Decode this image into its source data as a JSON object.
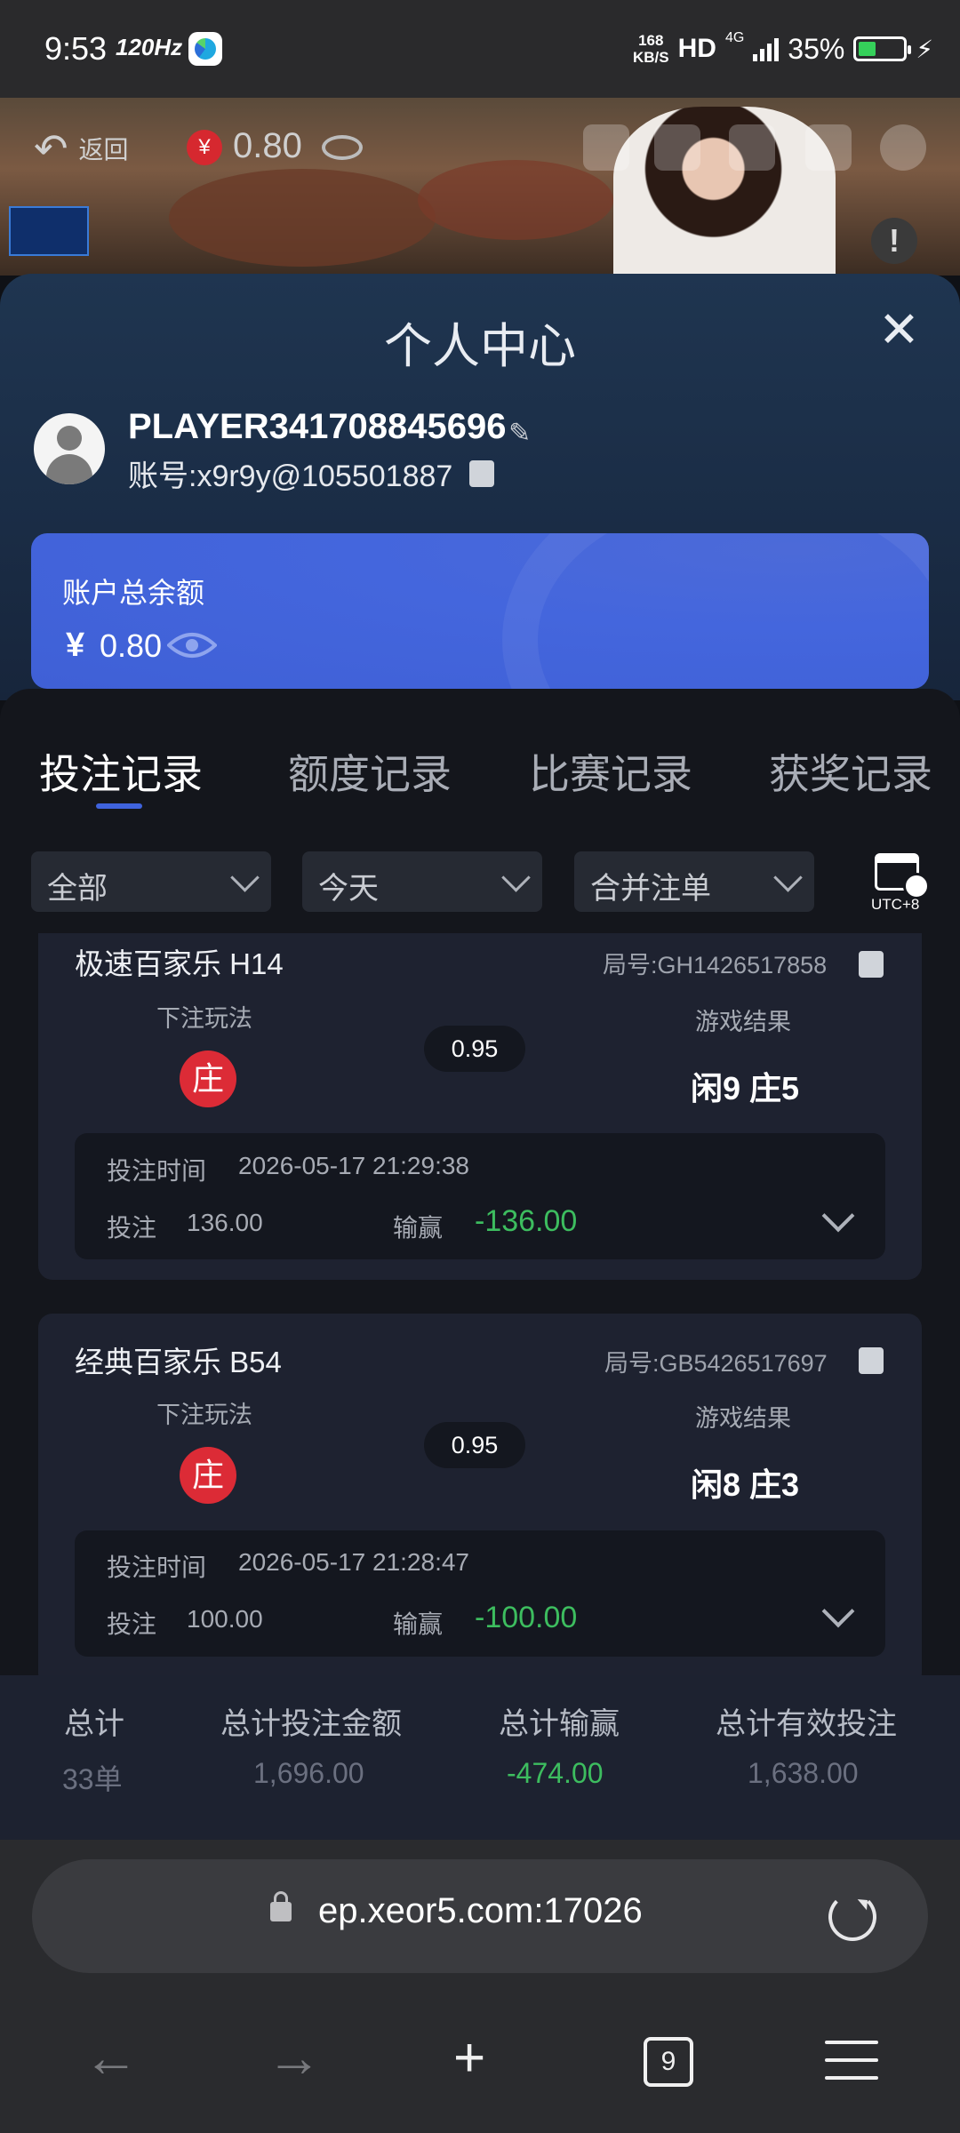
{
  "status_bar": {
    "time": "9:53",
    "refresh": "120Hz",
    "speed_top": "168",
    "speed_unit": "KB/S",
    "hd": "HD",
    "network": "4G",
    "battery": "35%"
  },
  "video_overlay": {
    "back_label": "返回",
    "currency_symbol": "¥",
    "balance": "0.80",
    "alert": "!"
  },
  "panel": {
    "title": "个人中心",
    "close": "✕",
    "username": "PLAYER341708845696",
    "account_label": "账号:",
    "account": "x9r9y@105501887"
  },
  "balance_card": {
    "label": "账户总余额",
    "currency": "¥",
    "amount": "0.80"
  },
  "tabs": [
    {
      "label": "投注记录",
      "active": true
    },
    {
      "label": "额度记录",
      "active": false
    },
    {
      "label": "比赛记录",
      "active": false
    },
    {
      "label": "获奖记录",
      "active": false
    }
  ],
  "filters": {
    "type": "全部",
    "date": "今天",
    "mode": "合并注单",
    "timezone": "UTC+8"
  },
  "records": [
    {
      "game": "极速百家乐 H14",
      "round": "局号:GH1426517858",
      "bet_type_label": "下注玩法",
      "bet_side": "庄",
      "odds": "0.95",
      "result_label": "游戏结果",
      "result": "闲9 庄5",
      "time_label": "投注时间",
      "time": "2026-05-17 21:29:38",
      "stake_label": "投注",
      "stake": "136.00",
      "winloss_label": "输赢",
      "winloss": "-136.00"
    },
    {
      "game": "经典百家乐 B54",
      "round": "局号:GB5426517697",
      "bet_type_label": "下注玩法",
      "bet_side": "庄",
      "odds": "0.95",
      "result_label": "游戏结果",
      "result": "闲8 庄3",
      "time_label": "投注时间",
      "time": "2026-05-17 21:28:47",
      "stake_label": "投注",
      "stake": "100.00",
      "winloss_label": "输赢",
      "winloss": "-100.00"
    }
  ],
  "totals": {
    "count_label": "总计",
    "count": "33单",
    "stake_label": "总计投注金额",
    "stake": "1,696.00",
    "winloss_label": "总计输赢",
    "winloss": "-474.00",
    "valid_label": "总计有效投注",
    "valid": "1,638.00"
  },
  "browser": {
    "url": "ep.xeor5.com:17026",
    "tab_count": "9"
  },
  "colors": {
    "accent": "#3f63dd",
    "banker": "#dc2b36",
    "loss_green": "#3dbd5f",
    "card_bg": "#1e2230"
  }
}
